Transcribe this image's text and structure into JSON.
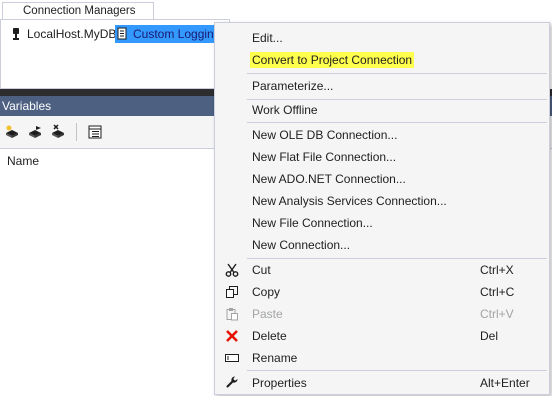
{
  "connection_managers": {
    "tab_label": "Connection Managers",
    "items": [
      {
        "label": "LocalHost.MyDB",
        "icon": "database-plug-icon"
      },
      {
        "label": "Custom Logging",
        "icon": "log-provider-icon",
        "selected": true
      }
    ]
  },
  "variables": {
    "header": "Variables",
    "toolbar": [
      {
        "icon": "add-variable-icon"
      },
      {
        "icon": "move-variable-icon"
      },
      {
        "icon": "delete-variable-icon"
      },
      {
        "icon": "grid-options-icon"
      }
    ],
    "columns": [
      "Name"
    ]
  },
  "context_menu": {
    "items": [
      {
        "label": "Edit...",
        "shortcut": ""
      },
      {
        "label": "Convert to Project Connection",
        "shortcut": "",
        "highlighted": true,
        "highlight_color": "#ffff4d"
      },
      {
        "label": "Parameterize...",
        "shortcut": ""
      },
      {
        "label": "Work Offline",
        "shortcut": ""
      },
      {
        "label": "New OLE DB Connection...",
        "shortcut": ""
      },
      {
        "label": "New Flat File Connection...",
        "shortcut": ""
      },
      {
        "label": "New ADO.NET Connection...",
        "shortcut": ""
      },
      {
        "label": "New Analysis Services Connection...",
        "shortcut": ""
      },
      {
        "label": "New File Connection...",
        "shortcut": ""
      },
      {
        "label": "New Connection...",
        "shortcut": ""
      },
      {
        "label": "Cut",
        "shortcut": "Ctrl+X",
        "icon": "scissors-icon"
      },
      {
        "label": "Copy",
        "shortcut": "Ctrl+C",
        "icon": "copy-icon"
      },
      {
        "label": "Paste",
        "shortcut": "Ctrl+V",
        "icon": "paste-icon",
        "disabled": true
      },
      {
        "label": "Delete",
        "shortcut": "Del",
        "icon": "delete-x-icon"
      },
      {
        "label": "Rename",
        "shortcut": "",
        "icon": "rename-icon"
      },
      {
        "label": "Properties",
        "shortcut": "Alt+Enter",
        "icon": "wrench-icon"
      }
    ]
  },
  "colors": {
    "selection": "#3399ff",
    "pane_header": "#4d6082",
    "highlight": "#ffff4d",
    "delete_red": "#e51400"
  }
}
